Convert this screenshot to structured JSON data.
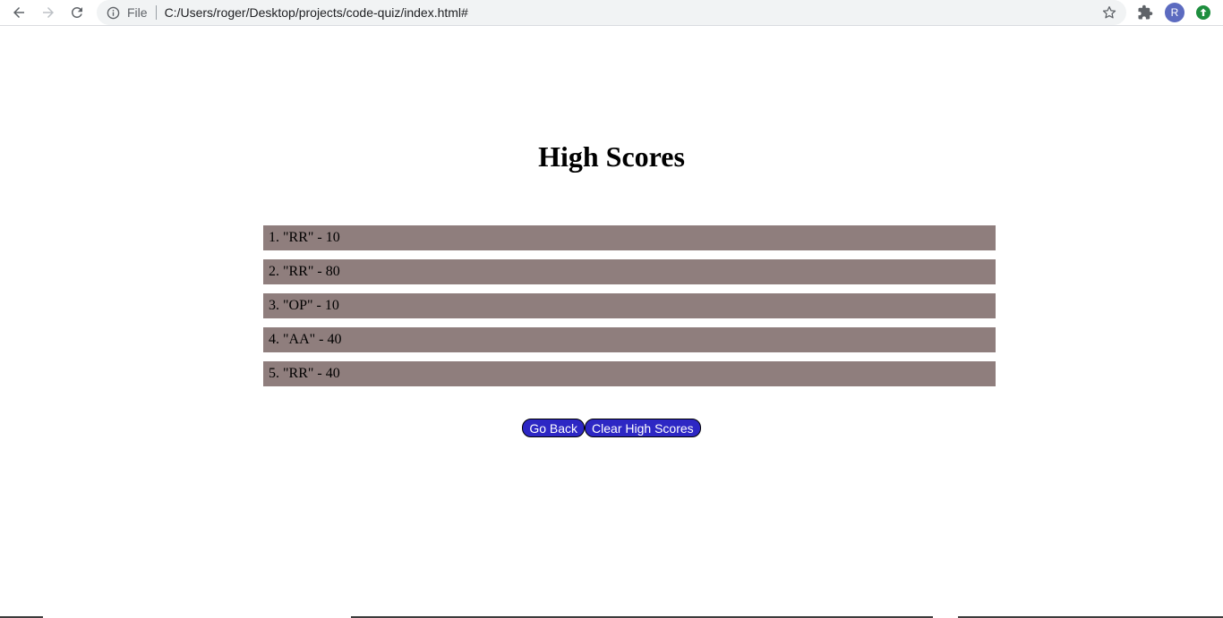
{
  "browser": {
    "scheme_label": "File",
    "url": "C:/Users/roger/Desktop/projects/code-quiz/index.html#",
    "profile_initial": "R",
    "icons": {
      "back": "back-arrow-icon",
      "forward": "forward-arrow-icon",
      "reload": "reload-icon",
      "info": "info-icon",
      "bookmark": "star-icon",
      "extensions": "puzzle-icon",
      "update": "update-arrow-icon"
    }
  },
  "page": {
    "title": "High Scores",
    "scores": [
      "1. \"RR\" - 10",
      "2. \"RR\" - 80",
      "3. \"OP\" - 10",
      "4. \"AA\" - 40",
      "5. \"RR\" - 40"
    ],
    "buttons": {
      "go_back": "Go Back",
      "clear": "Clear High Scores"
    },
    "colors": {
      "score_row_bg": "#8f7e7d",
      "button_bg": "#2d27c4",
      "button_text": "#ffffff"
    }
  }
}
